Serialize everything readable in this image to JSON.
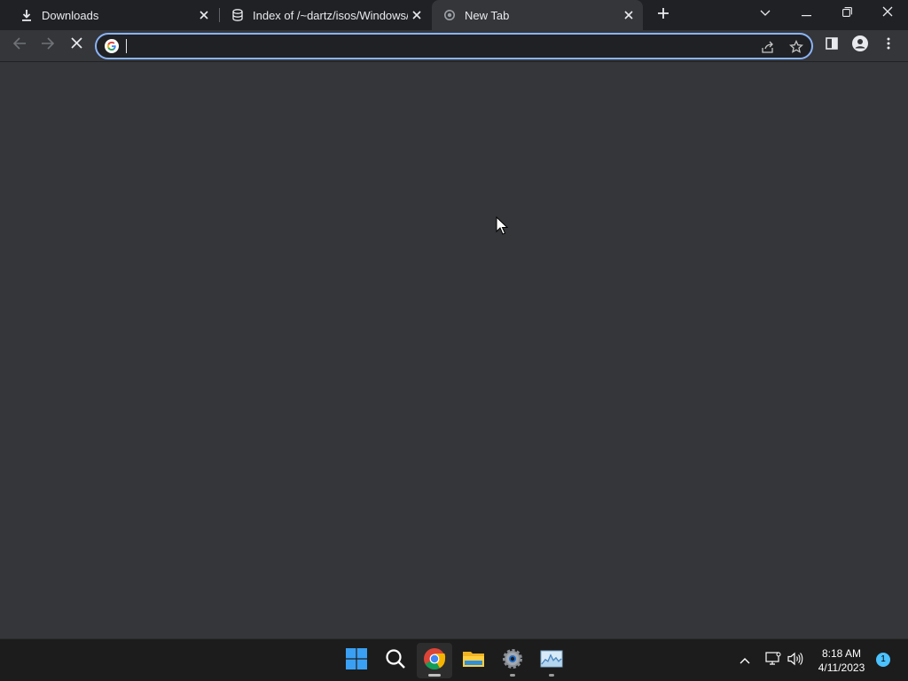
{
  "browser": {
    "tabs": [
      {
        "title": "Downloads",
        "icon": "download-icon",
        "active": false
      },
      {
        "title": "Index of /~dartz/isos/Windows/",
        "icon": "site-favicon-icon",
        "active": false
      },
      {
        "title": "New Tab",
        "icon": "loading-spinner-icon",
        "active": true
      }
    ],
    "omnibox": {
      "value": "",
      "placeholder": ""
    },
    "accent_color": "#8ab4f8"
  },
  "taskbar": {
    "apps": [
      "start-icon",
      "search-icon",
      "chrome-icon",
      "file-explorer-icon",
      "settings-icon",
      "task-manager-icon"
    ],
    "clock": {
      "time": "8:18 AM",
      "date": "4/11/2023"
    },
    "notification_count": "1"
  }
}
